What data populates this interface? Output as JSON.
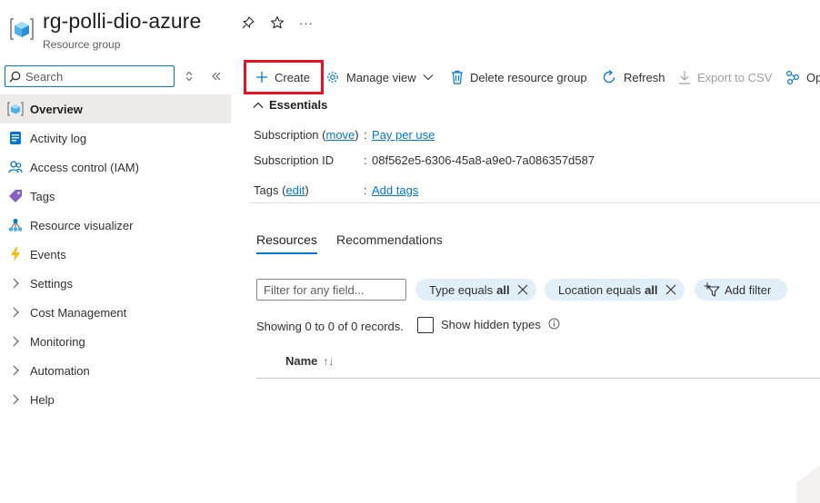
{
  "header": {
    "title": "rg-polli-dio-azure",
    "subtitle": "Resource group",
    "actions": [
      {
        "name": "pin-icon"
      },
      {
        "name": "star-icon"
      },
      {
        "name": "more-icon",
        "label": "···"
      }
    ]
  },
  "sidebar": {
    "search_placeholder": "Search",
    "items": [
      {
        "label": "Overview",
        "icon": "resource-group-icon",
        "active": true,
        "expandable": false
      },
      {
        "label": "Activity log",
        "icon": "activity-log-icon",
        "active": false,
        "expandable": false
      },
      {
        "label": "Access control (IAM)",
        "icon": "people-icon",
        "active": false,
        "expandable": false
      },
      {
        "label": "Tags",
        "icon": "tag-icon",
        "active": false,
        "expandable": false
      },
      {
        "label": "Resource visualizer",
        "icon": "hierarchy-icon",
        "active": false,
        "expandable": false
      },
      {
        "label": "Events",
        "icon": "lightning-icon",
        "active": false,
        "expandable": false
      },
      {
        "label": "Settings",
        "icon": "chevron-right-icon",
        "active": false,
        "expandable": true
      },
      {
        "label": "Cost Management",
        "icon": "chevron-right-icon",
        "active": false,
        "expandable": true
      },
      {
        "label": "Monitoring",
        "icon": "chevron-right-icon",
        "active": false,
        "expandable": true
      },
      {
        "label": "Automation",
        "icon": "chevron-right-icon",
        "active": false,
        "expandable": true
      },
      {
        "label": "Help",
        "icon": "chevron-right-icon",
        "active": false,
        "expandable": true
      }
    ]
  },
  "toolbar": {
    "create_label": "Create",
    "manage_view_label": "Manage view",
    "delete_label": "Delete resource group",
    "refresh_label": "Refresh",
    "export_label": "Export to CSV",
    "open_label": "Op"
  },
  "essentials": {
    "label": "Essentials",
    "subscription_key": "Subscription",
    "subscription_move": "move",
    "subscription_value": "Pay per use",
    "subscription_id_key": "Subscription ID",
    "subscription_id_value": "08f562e5-6306-45a8-a9e0-7a086357d587",
    "tags_key": "Tags",
    "tags_edit": "edit",
    "tags_value": "Add tags",
    "colon": ":"
  },
  "tabs": [
    {
      "label": "Resources",
      "active": true
    },
    {
      "label": "Recommendations",
      "active": false
    }
  ],
  "filters": {
    "placeholder": "Filter for any field...",
    "type_pill_prefix": "Type equals",
    "type_pill_value": "all",
    "location_pill_prefix": "Location equals",
    "location_pill_value": "all",
    "add_filter_label": "Add filter"
  },
  "records": {
    "text": "Showing 0 to 0 of 0 records.",
    "show_hidden_label": "Show hidden types"
  },
  "table": {
    "column_name": "Name",
    "sort_glyph": "↑↓"
  },
  "colors": {
    "accent": "#0078d4",
    "highlight": "#e81123",
    "active_nav_bg": "#edebe9",
    "pill_bg": "#e1eff9"
  }
}
